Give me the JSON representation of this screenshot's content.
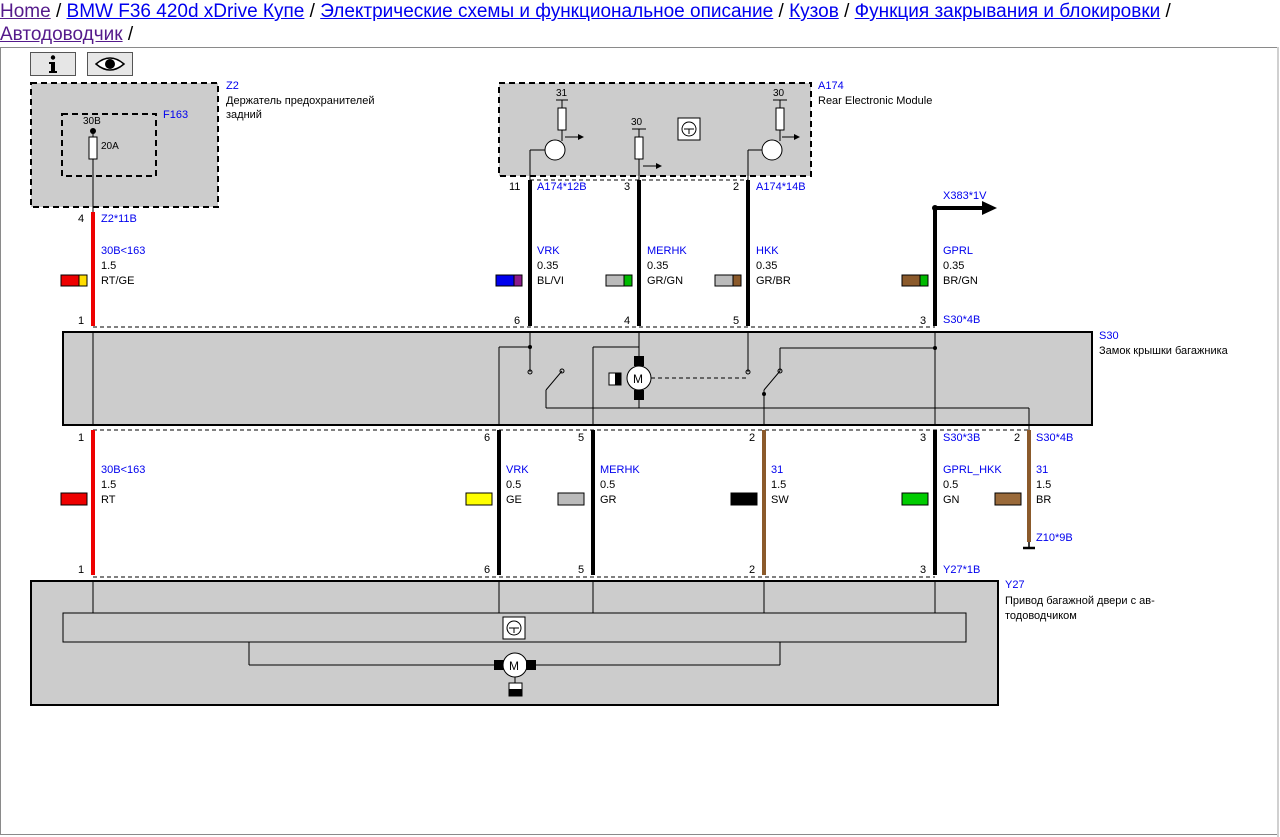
{
  "breadcrumb": {
    "home": "Home",
    "model": "BMW F36 420d xDrive Купе",
    "section": "Электрические схемы и функциональное описание",
    "group": "Кузов",
    "function": "Функция закрывания и блокировки",
    "page": "Автодоводчик",
    "sep": "/"
  },
  "toolbar": {
    "info_icon": "info-icon",
    "view_icon": "eye-icon"
  },
  "colors": {
    "red": "#ee0000",
    "brown": "#8b5a2b",
    "blue_label": "#0000ee",
    "component_fill": "#cccccc"
  },
  "components": {
    "z2": {
      "id": "Z2",
      "name_line1": "Держатель предохранителей",
      "name_line2": "задний"
    },
    "f163": {
      "id": "F163",
      "terminal": "30B",
      "rating": "20A"
    },
    "a174": {
      "id": "A174",
      "name": "Rear Electronic Module",
      "t31": "31",
      "t30a": "30",
      "t30b": "30"
    },
    "s30": {
      "id": "S30",
      "name": "Замок крышки багажника"
    },
    "y27": {
      "id": "Y27",
      "name_line1": "Привод багажной двери с ав-",
      "name_line2": "тодоводчиком"
    }
  },
  "connectors": {
    "z2_11b": "Z2*11B",
    "a174_12b": "A174*12B",
    "a174_14b": "A174*14B",
    "x383_1v": "X383*1V",
    "s30_4b_top": "S30*4B",
    "s30_3b": "S30*3B",
    "s30_4b_bot": "S30*4B",
    "z10_9b": "Z10*9B",
    "y27_1b": "Y27*1B"
  },
  "pins": {
    "p4": "4",
    "p11": "11",
    "p3": "3",
    "p2": "2",
    "s30_top": [
      "1",
      "6",
      "4",
      "5",
      "3"
    ],
    "s30_bottom": [
      "1",
      "6",
      "5",
      "2",
      "3",
      "2"
    ],
    "y27_top": [
      "1",
      "6",
      "5",
      "2",
      "3"
    ]
  },
  "wires_top": [
    {
      "name": "30B<163",
      "size": "1.5",
      "color": "RT/GE"
    },
    {
      "name": "VRK",
      "size": "0.35",
      "color": "BL/VI"
    },
    {
      "name": "MERHK",
      "size": "0.35",
      "color": "GR/GN"
    },
    {
      "name": "HKK",
      "size": "0.35",
      "color": "GR/BR"
    },
    {
      "name": "GPRL",
      "size": "0.35",
      "color": "BR/GN"
    }
  ],
  "wires_bottom": [
    {
      "name": "30B<163",
      "size": "1.5",
      "color": "RT"
    },
    {
      "name": "VRK",
      "size": "0.5",
      "color": "GE"
    },
    {
      "name": "MERHK",
      "size": "0.5",
      "color": "GR"
    },
    {
      "name": "31",
      "size": "1.5",
      "color": "SW"
    },
    {
      "name": "GPRL_HKK",
      "size": "0.5",
      "color": "GN"
    },
    {
      "name": "31",
      "size": "1.5",
      "color": "BR"
    }
  ]
}
